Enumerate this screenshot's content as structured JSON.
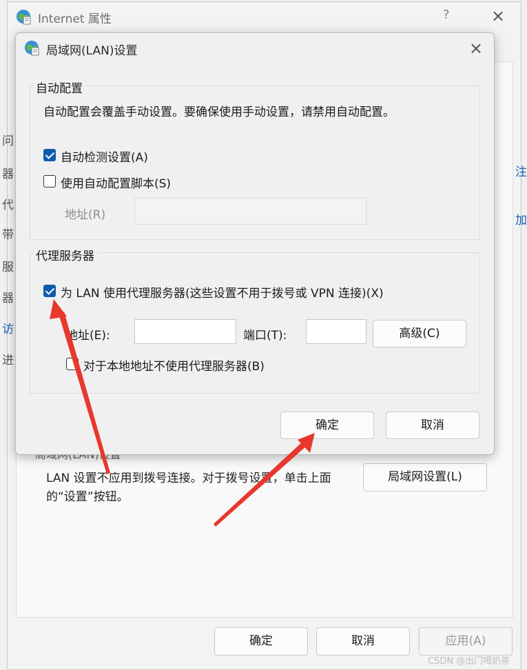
{
  "outer_window": {
    "title": "Internet 属性",
    "help_glyph": "?",
    "close_glyph": "×",
    "side_fragments": [
      "问",
      "器",
      "代",
      "带",
      "服",
      "器",
      "访",
      "进"
    ],
    "right_fragments": [
      "注",
      "加"
    ],
    "lan_group_fragment": "局域网(LAN)设置",
    "lan_description": "LAN 设置不应用到拨号连接。对于拨号设置，单击上面的“设置”按钮。",
    "lan_settings_button": "局域网设置(L)",
    "ok_button": "确定",
    "cancel_button": "取消",
    "apply_button": "应用(A)",
    "apply_enabled": false
  },
  "lan_dialog": {
    "title": "局域网(LAN)设置",
    "close_glyph": "×",
    "auto_config": {
      "group_title": "自动配置",
      "description": "自动配置会覆盖手动设置。要确保使用手动设置，请禁用自动配置。",
      "auto_detect_label": "自动检测设置(A)",
      "auto_detect_checked": true,
      "use_script_label": "使用自动配置脚本(S)",
      "use_script_checked": false,
      "address_label": "地址(R)",
      "address_value": "",
      "address_enabled": false
    },
    "proxy": {
      "group_title": "代理服务器",
      "use_proxy_label": "为 LAN 使用代理服务器(这些设置不用于拨号或 VPN 连接)(X)",
      "use_proxy_checked": true,
      "address_label": "地址(E):",
      "address_value": "",
      "port_label": "端口(T):",
      "port_value": "",
      "advanced_button": "高级(C)",
      "bypass_local_label": "对于本地地址不使用代理服务器(B)",
      "bypass_local_checked": false
    },
    "ok_button": "确定",
    "cancel_button": "取消"
  },
  "watermark": "CSDN @出门喝奶茶",
  "annotation_color": "#e8372c",
  "checkbox_accent": "#0b5cad"
}
